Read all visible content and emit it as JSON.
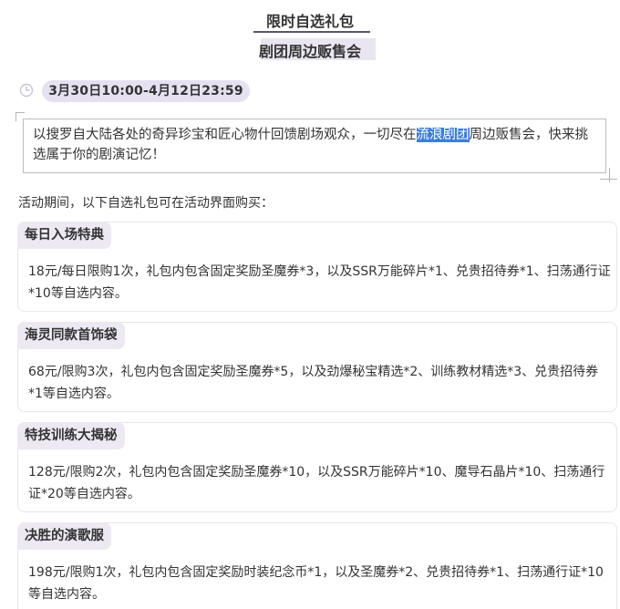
{
  "header": {
    "title_line1": "限时自选礼包",
    "title_line2": "剧团周边贩售会"
  },
  "event": {
    "date_range": "3月30日10:00-4月12日23:59",
    "clock_icon": "clock-icon"
  },
  "intro": {
    "text_before": "以搜罗自大陆各处的奇异珍宝和匠心物什回馈剧场观众，一切尽在",
    "highlight": "流浪剧团",
    "text_after": "周边贩售会，快来挑选属于你的剧演记忆！"
  },
  "period_label": "活动期间，以下自选礼包可在活动界面购买：",
  "packs": [
    {
      "name": "每日入场特典",
      "desc": "18元/每日限购1次，礼包内包含固定奖励圣魔券*3，以及SSR万能碎片*1、兑贵招待券*1、扫荡通行证*10等自选内容。"
    },
    {
      "name": "海灵同款首饰袋",
      "desc": "68元/限购3次，礼包内包含固定奖励圣魔券*5，以及劲爆秘宝精选*2、训练教材精选*3、兑贵招待券*1等自选内容。"
    },
    {
      "name": "特技训练大揭秘",
      "desc": "128元/限购2次，礼包内包含固定奖励圣魔券*10，以及SSR万能碎片*10、魔导石晶片*10、扫荡通行证*20等自选内容。"
    },
    {
      "name": "决胜的演歌服",
      "desc": "198元/限购1次，礼包内包含固定奖励时装纪念币*1，以及圣魔券*2、兑贵招待券*1、扫荡通行证*10等自选内容。"
    }
  ]
}
